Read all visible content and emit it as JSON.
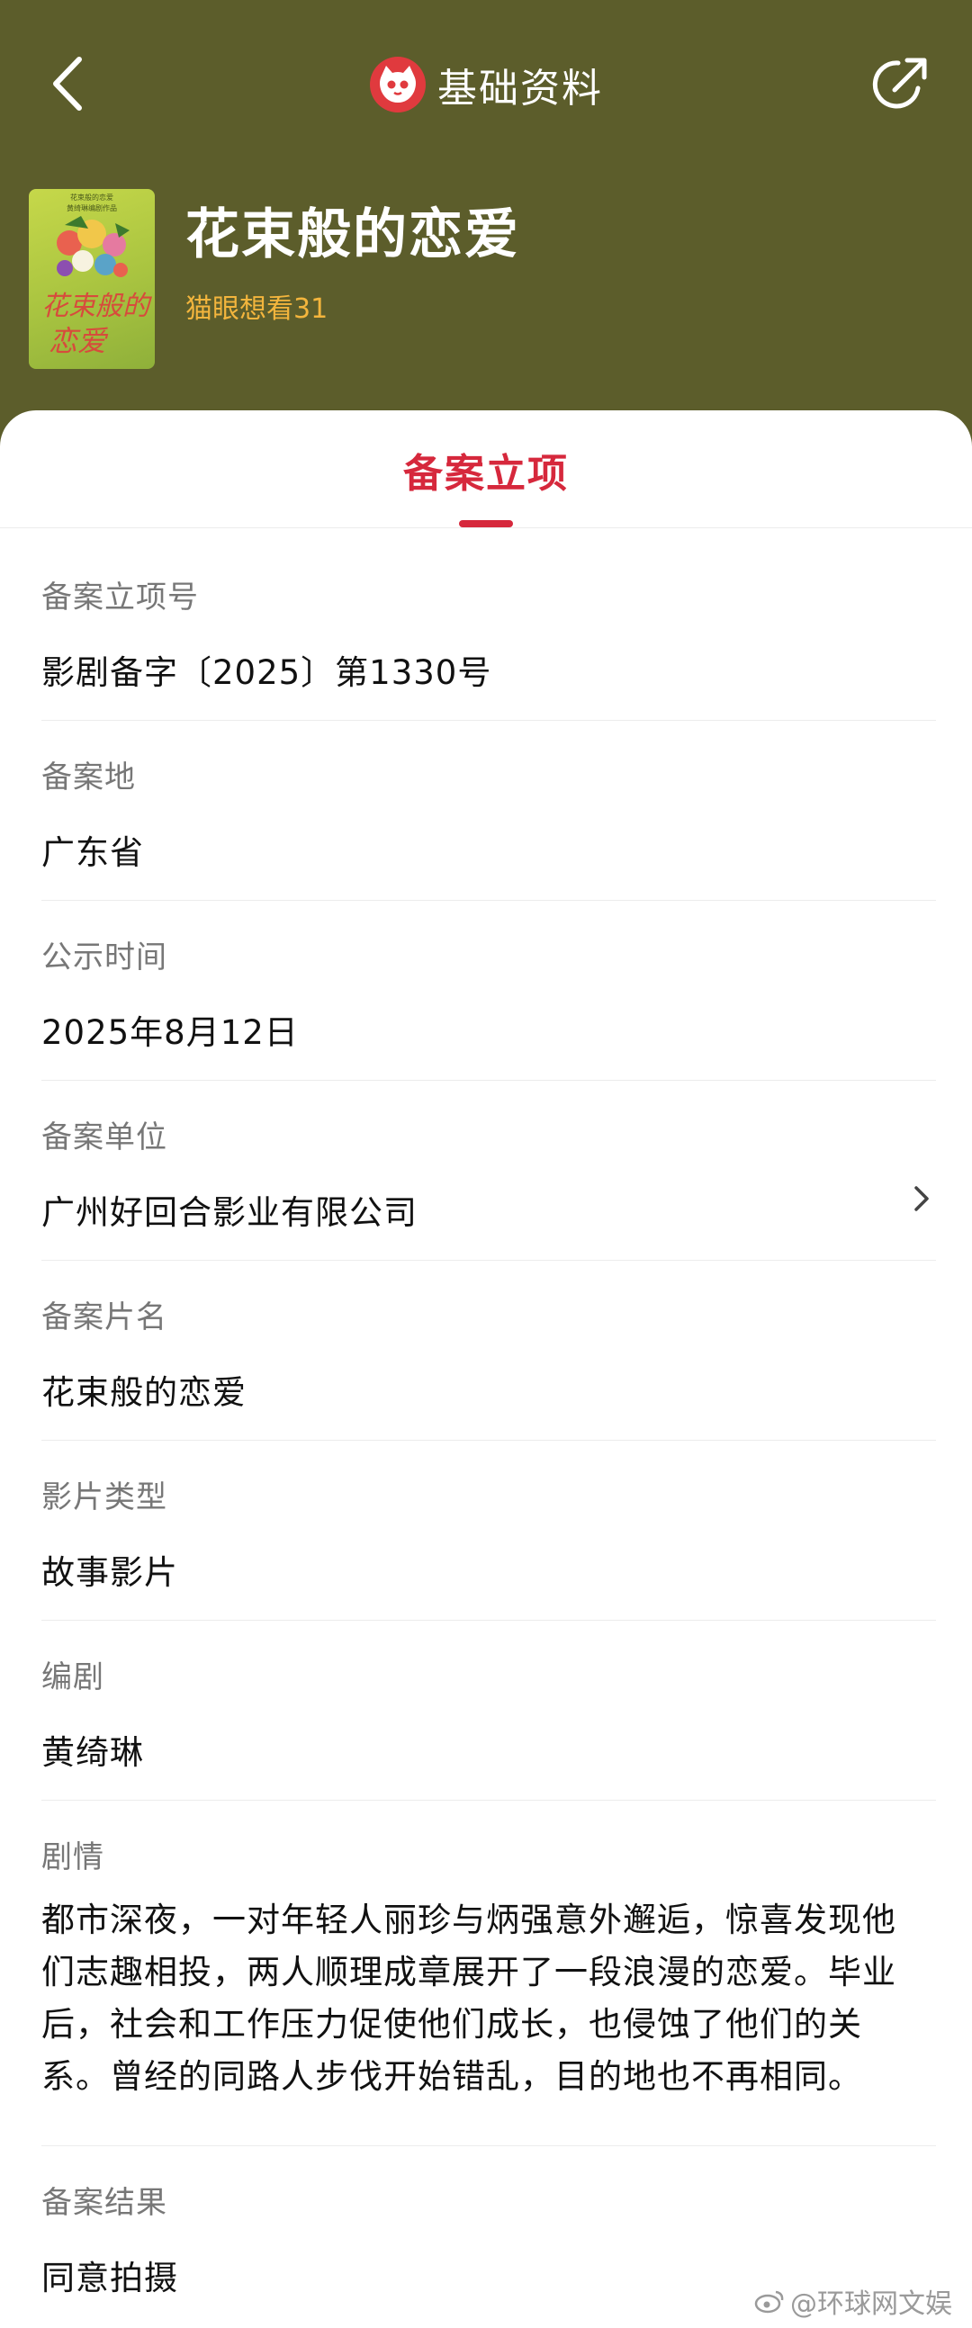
{
  "header": {
    "title": "基础资料",
    "back_icon": "chevron-left-icon",
    "share_icon": "share-icon",
    "logo_icon": "maoyan-cat-logo",
    "background_color": "#5c5d2b"
  },
  "movie": {
    "title": "花束般的恋爱",
    "want_to_see": "猫眼想看31",
    "poster": {
      "top_text_1": "花束般的恋爱",
      "top_text_2": "黄绮琳编剧作品",
      "calligraphy_1": "花束般的",
      "calligraphy_2": "恋爱"
    }
  },
  "tabs": [
    {
      "label": "备案立项",
      "active": true
    }
  ],
  "fields": [
    {
      "label": "备案立项号",
      "value": "影剧备字〔2025〕第1330号"
    },
    {
      "label": "备案地",
      "value": "广东省"
    },
    {
      "label": "公示时间",
      "value": "2025年8月12日"
    },
    {
      "label": "备案单位",
      "value": "广州好回合影业有限公司"
    },
    {
      "label": "备案片名",
      "value": "花束般的恋爱"
    },
    {
      "label": "影片类型",
      "value": "故事影片"
    },
    {
      "label": "编剧",
      "value": "黄绮琳"
    },
    {
      "label": "剧情",
      "value_lines": [
        "都市深夜，一对年轻人丽珍与炳强意外邂逅，惊喜发现他",
        "们志趣相投，两人顺理成章展开了一段浪漫的恋爱。毕业",
        "后，社会和工作压力促使他们成长，也侵蚀了他们的关",
        "系。曾经的同路人步伐开始错乱，目的地也不再相同。"
      ]
    },
    {
      "label": "备案结果",
      "value": "同意拍摄"
    }
  ],
  "watermark": "@环球网文娱",
  "colors": {
    "accent": "#d6283c",
    "want_count": "#f3b53d"
  }
}
